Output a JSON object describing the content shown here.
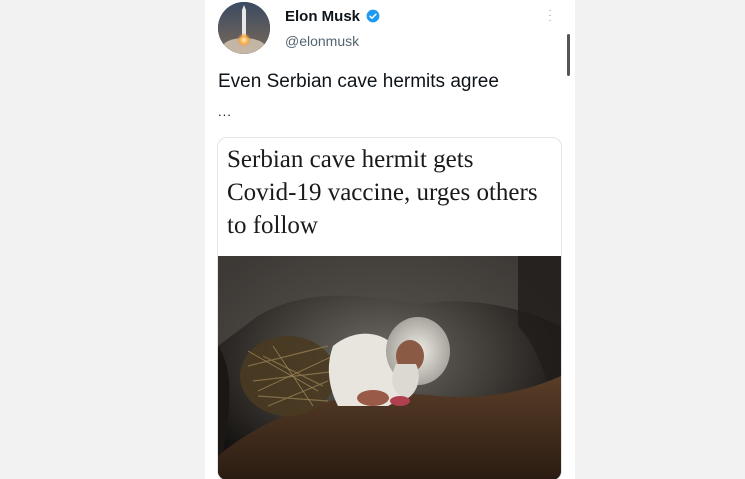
{
  "tweet": {
    "author": {
      "display_name": "Elon Musk",
      "handle": "@elonmusk",
      "verified": true
    },
    "text": "Even Serbian cave hermits agree",
    "ellipsis": "...",
    "article": {
      "headline": "Serbian cave hermit gets Covid-19 vaccine, urges others to follow"
    }
  },
  "icons": {
    "verified": "verified-badge-icon",
    "more": "more-options-icon",
    "avatar": "rocket-launch-avatar"
  },
  "colors": {
    "verified_blue": "#1d9bf0",
    "text_primary": "#0f1419",
    "text_secondary": "#536471"
  }
}
